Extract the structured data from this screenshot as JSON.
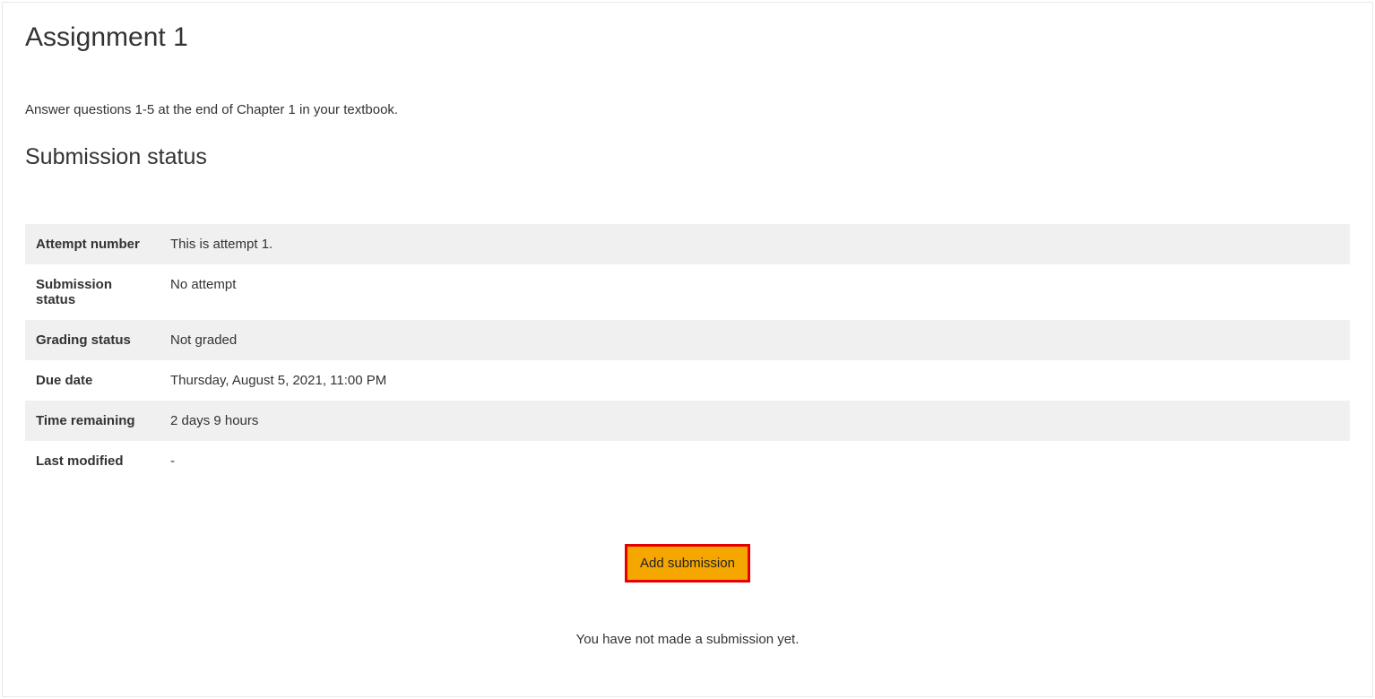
{
  "page": {
    "title": "Assignment 1",
    "description": "Answer questions 1-5 at the end of Chapter 1 in your textbook.",
    "section_heading": "Submission status"
  },
  "status_table": {
    "rows": [
      {
        "label": "Attempt number",
        "value": "This is attempt 1."
      },
      {
        "label": "Submission status",
        "value": "No attempt"
      },
      {
        "label": "Grading status",
        "value": "Not graded"
      },
      {
        "label": "Due date",
        "value": "Thursday, August 5, 2021, 11:00 PM"
      },
      {
        "label": "Time remaining",
        "value": "2 days 9 hours"
      },
      {
        "label": "Last modified",
        "value": "-"
      }
    ]
  },
  "actions": {
    "add_submission_label": "Add submission"
  },
  "messages": {
    "no_submission": "You have not made a submission yet."
  }
}
